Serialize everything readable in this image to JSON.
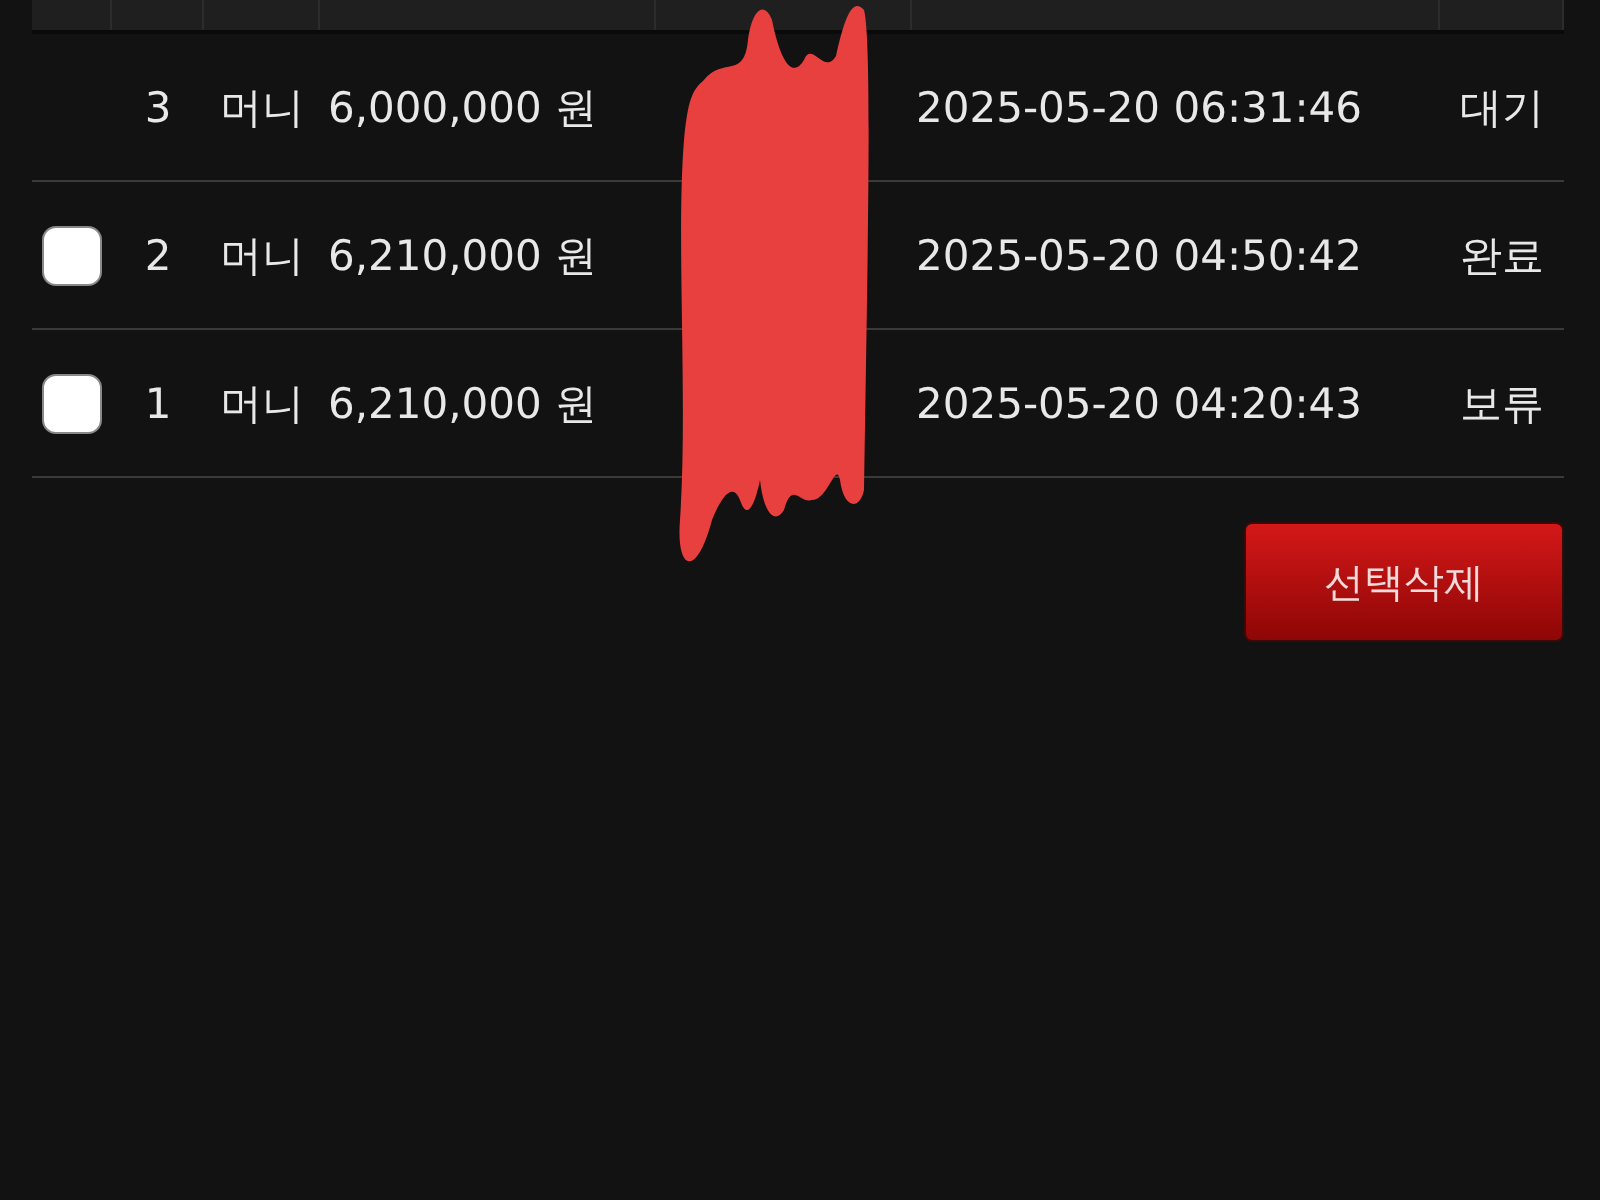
{
  "table": {
    "rows": [
      {
        "kind": "plain",
        "checked": false,
        "number": "3",
        "type": "머니",
        "amount": "6,000,000 원",
        "date": "2025-05-20 06:31:46",
        "status": "대기"
      },
      {
        "kind": "checkbox",
        "checked": false,
        "number": "2",
        "type": "머니",
        "amount": "6,210,000 원",
        "date": "2025-05-20 04:50:42",
        "status": "완료"
      },
      {
        "kind": "checkbox",
        "checked": false,
        "number": "1",
        "type": "머니",
        "amount": "6,210,000 원",
        "date": "2025-05-20 04:20:43",
        "status": "보류"
      }
    ]
  },
  "delete_button": "선택삭제"
}
